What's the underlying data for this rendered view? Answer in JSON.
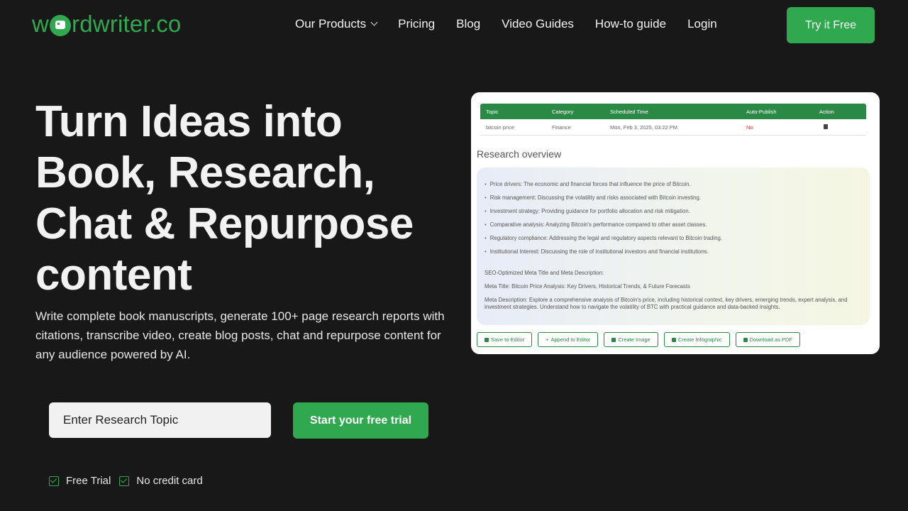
{
  "header": {
    "logo_text_left": "w",
    "logo_text_right": "rdwriter.co",
    "nav": [
      {
        "label": "Our Products",
        "has_dropdown": true
      },
      {
        "label": "Pricing"
      },
      {
        "label": "Blog"
      },
      {
        "label": "Video Guides"
      },
      {
        "label": "How-to guide"
      },
      {
        "label": "Login"
      }
    ],
    "cta_label": "Try it Free"
  },
  "hero": {
    "title_lines": [
      "Turn Ideas into",
      "Book, Research,",
      "Chat & Repurpose",
      "content"
    ],
    "subtitle": "Write complete book manuscripts, generate 100+ page research reports with citations, transcribe video, create blog posts, chat and repurpose content for any audience powered by AI.",
    "input_placeholder": "Enter Research Topic",
    "trial_button": "Start your free trial",
    "checks": [
      "Free Trial",
      "No credit card"
    ]
  },
  "card": {
    "table": {
      "headers": [
        "Topic",
        "Category",
        "Scheduled Time",
        "Auto-Publish",
        "Action"
      ],
      "row": {
        "topic": "bitcoin price",
        "category": "Finance",
        "time": "Mon, Feb 3, 2025, 03:22 PM",
        "auto_publish": "No"
      }
    },
    "overview_title": "Research overview",
    "bullets": [
      "Price drivers: The economic and financial forces that influence the price of Bitcoin.",
      "Risk management: Discussing the volatility and risks associated with Bitcoin investing.",
      "Investment strategy: Providing guidance for portfolio allocation and risk mitigation.",
      "Comparative analysis: Analyzing Bitcoin's performance compared to other asset classes.",
      "Regulatory compliance: Addressing the legal and regulatory aspects relevant to Bitcoin trading.",
      "Institutional Interest: Discussing the role of institutional investors and financial institutions."
    ],
    "seo_heading": "SEO-Optimized Meta Title and Meta Description:",
    "meta_title": "Meta Title: Bitcoin Price Analysis: Key Drivers, Historical Trends, & Future Forecasts",
    "meta_description": "Meta Description: Explore a comprehensive analysis of Bitcoin's price, including historical context, key drivers, emerging trends, expert analysis, and investment strategies. Understand how to navigate the volatility of BTC with practical guidance and data-backed insights.",
    "buttons": [
      "Save to Editor",
      "Append to Editor",
      "Create Image",
      "Create Infographic",
      "Download as PDF"
    ]
  },
  "colors": {
    "accent": "#2fa84f",
    "background": "#181818",
    "table_header": "#2a8a45",
    "no_red": "#e53935"
  }
}
